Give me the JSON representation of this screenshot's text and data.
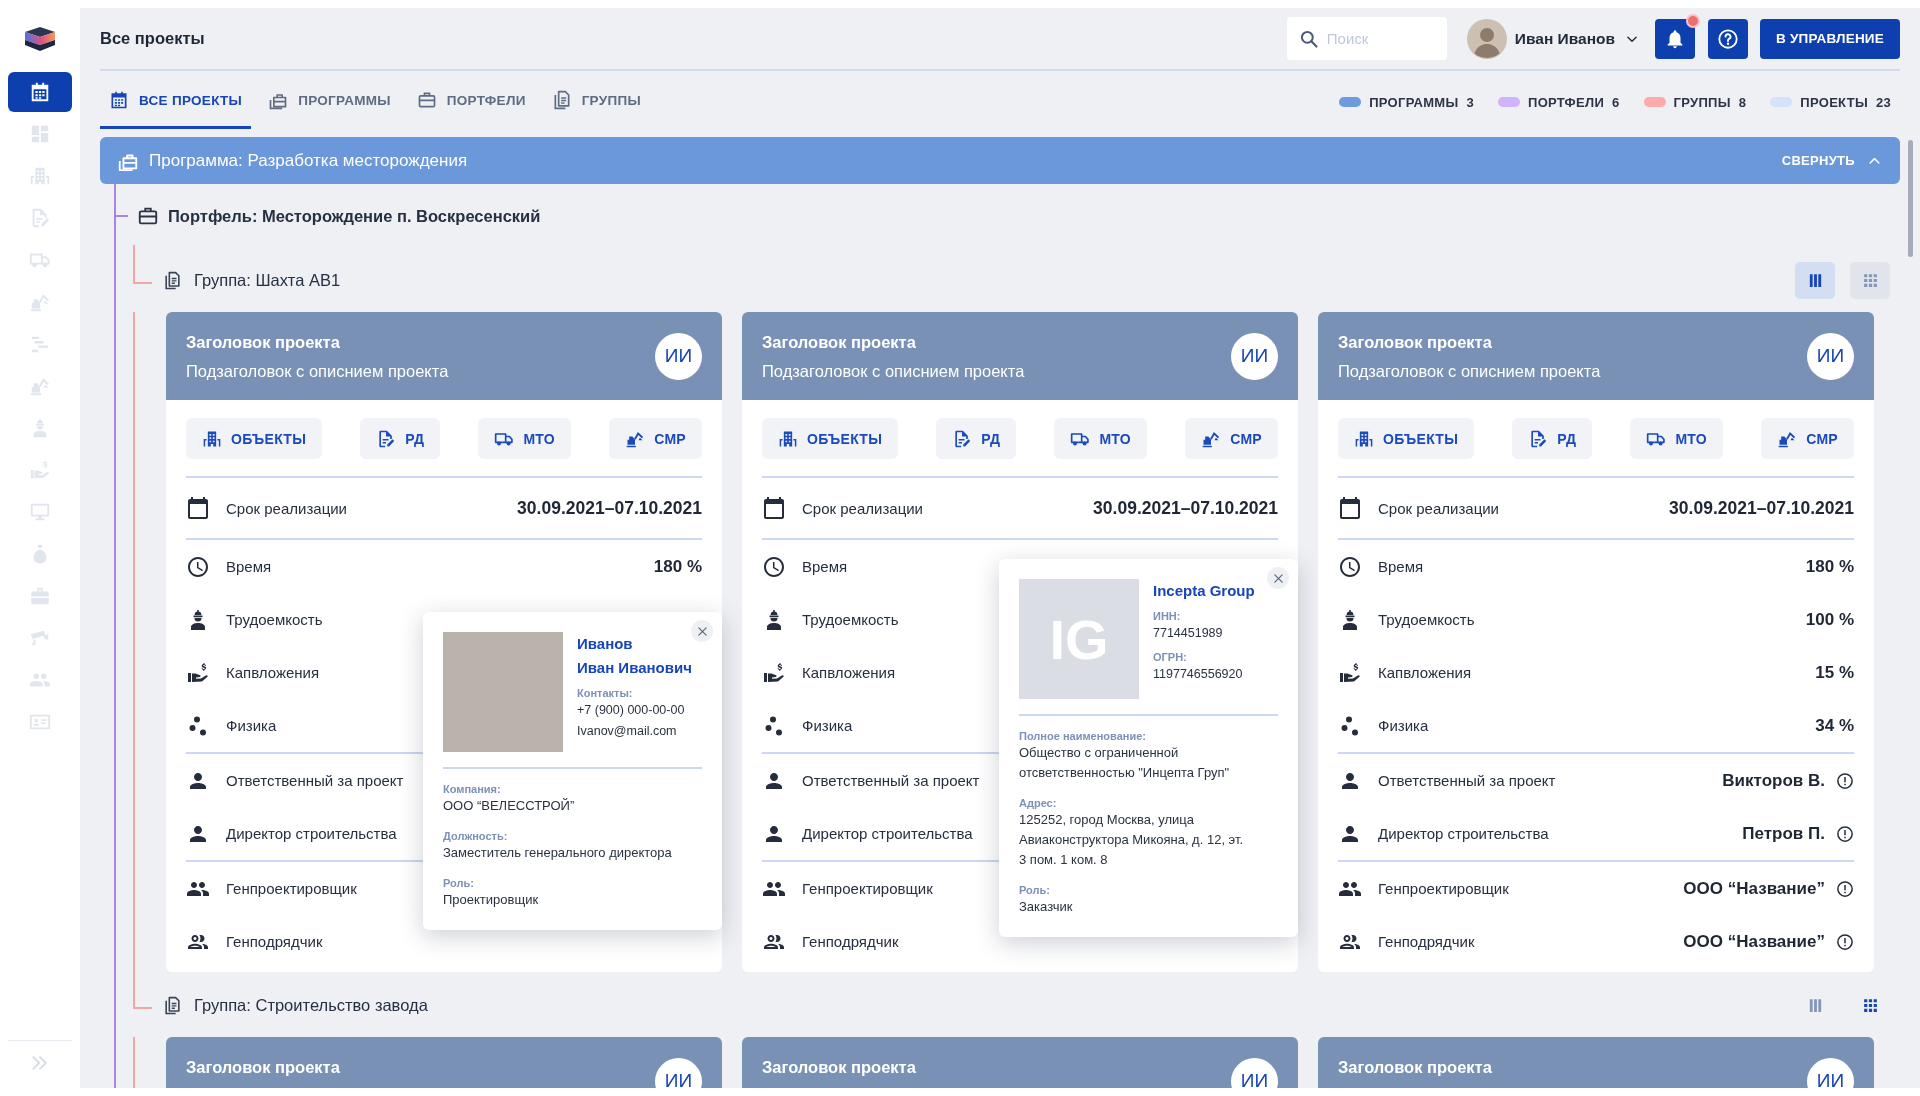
{
  "sidebar": {
    "items": [
      {
        "selected": true
      },
      {
        "selected": false
      },
      {
        "selected": false
      },
      {
        "selected": false
      },
      {
        "selected": false
      },
      {
        "selected": false
      },
      {
        "selected": false
      },
      {
        "selected": false
      },
      {
        "selected": false
      },
      {
        "selected": false
      },
      {
        "selected": false
      },
      {
        "selected": false
      },
      {
        "selected": false
      },
      {
        "selected": false
      },
      {
        "selected": false
      },
      {
        "selected": false
      }
    ]
  },
  "header": {
    "title": "Все проекты",
    "search": {
      "placeholder": "Поиск"
    },
    "user": {
      "name": "Иван Иванов"
    },
    "notifications": {
      "unread": true
    },
    "action_button": "В УПРАВЛЕНИЕ"
  },
  "tabs": [
    {
      "label": "ВСЕ ПРОЕКТЫ",
      "selected": true
    },
    {
      "label": "ПРОГРАММЫ",
      "selected": false
    },
    {
      "label": "ПОРТФЕЛИ",
      "selected": false
    },
    {
      "label": "ГРУППЫ",
      "selected": false
    }
  ],
  "legend": [
    {
      "label": "ПРОГРАММЫ",
      "count": "3",
      "color": "#6f9ade"
    },
    {
      "label": "ПОРТФЕЛИ",
      "count": "6",
      "color": "#d1b3fa"
    },
    {
      "label": "ГРУППЫ",
      "count": "8",
      "color": "#fcabab"
    },
    {
      "label": "ПРОЕКТЫ",
      "count": "23",
      "color": "#d6e1fb"
    }
  ],
  "program": {
    "title": "Программа: Разработка месторождения",
    "collapse_label": "СВЕРНУТЬ",
    "expanded": true,
    "portfolios": [
      {
        "title": "Портфель: Месторождение п. Воскресенский",
        "groups": [
          {
            "title": "Группа: Шахта АВ1",
            "hovered": true,
            "views": [
              {
                "selected": true
              },
              {
                "selected": false
              }
            ],
            "cards": [
              {
                "title": "Заголовок проекта",
                "subtitle": "Подзаголовок с описнием проекта",
                "avatar": "ИИ",
                "actions": [
                  "ОБЪЕКТЫ",
                  "РД",
                  "МТО",
                  "СМР"
                ],
                "sections": [
                  {
                    "rows": [
                      {
                        "label": "Срок реализации",
                        "value": "30.09.2021–07.10.2021"
                      }
                    ]
                  },
                  {
                    "rows": [
                      {
                        "label": "Время",
                        "value": "180 %"
                      },
                      {
                        "label": "Трудоемкость"
                      },
                      {
                        "label": "Капвложения"
                      },
                      {
                        "label": "Физика"
                      }
                    ]
                  },
                  {
                    "rows": [
                      {
                        "label": "Ответственный за проект",
                        "info": false
                      },
                      {
                        "label": "Директор строительства",
                        "info": false
                      }
                    ]
                  },
                  {
                    "rows": [
                      {
                        "label": "Генпроектировщик",
                        "info": false
                      },
                      {
                        "label": "Генподрядчик",
                        "info": false
                      }
                    ]
                  }
                ],
                "popup": {
                  "kind": "person",
                  "name_lines": [
                    "Иванов",
                    "Иван Иванович"
                  ],
                  "top_fields": [
                    {
                      "label": "Контакты:",
                      "values": [
                        "+7 (900) 000-00-00",
                        "Ivanov@mail.com"
                      ]
                    }
                  ],
                  "fields": [
                    {
                      "label": "Компания:",
                      "value": "ООО “ВЕЛЕССТРОЙ”"
                    },
                    {
                      "label": "Должность:",
                      "value": "Заместитель генерального директора"
                    },
                    {
                      "label": "Роль:",
                      "value": "Проектировщик"
                    }
                  ]
                }
              },
              {
                "title": "Заголовок проекта",
                "subtitle": "Подзаголовок с описнием проекта",
                "avatar": "ИИ",
                "actions": [
                  "ОБЪЕКТЫ",
                  "РД",
                  "МТО",
                  "СМР"
                ],
                "sections": [
                  {
                    "rows": [
                      {
                        "label": "Срок реализации",
                        "value": "30.09.2021–07.10.2021"
                      }
                    ]
                  },
                  {
                    "rows": [
                      {
                        "label": "Время"
                      },
                      {
                        "label": "Трудоемкость"
                      },
                      {
                        "label": "Капвложения"
                      },
                      {
                        "label": "Физика"
                      }
                    ]
                  },
                  {
                    "rows": [
                      {
                        "label": "Ответственный за проект",
                        "info": false
                      },
                      {
                        "label": "Директор строительства",
                        "info": false
                      }
                    ]
                  },
                  {
                    "rows": [
                      {
                        "label": "Генпроектировщик",
                        "info": false
                      },
                      {
                        "label": "Генподрядчик",
                        "info": false
                      }
                    ]
                  }
                ],
                "popup": {
                  "kind": "company",
                  "logo_text": "IG",
                  "name_lines": [
                    "Incepta Group"
                  ],
                  "top_fields": [
                    {
                      "label": "ИНН:",
                      "values": [
                        "7714451989"
                      ]
                    },
                    {
                      "label": "ОГРН:",
                      "values": [
                        "1197746556920"
                      ]
                    }
                  ],
                  "fields": [
                    {
                      "label": "Полное наименование:",
                      "value": "Общество с ограниченной отсветственностью \"Инцепта Груп\""
                    },
                    {
                      "label": "Адрес:",
                      "value": "125252, город Москва, улица Авиаконструктора Микояна, д. 12, эт. 3 пом. 1 ком. 8"
                    },
                    {
                      "label": "Роль:",
                      "value": "Заказчик"
                    }
                  ]
                }
              },
              {
                "title": "Заголовок проекта",
                "subtitle": "Подзаголовок с описнием проекта",
                "avatar": "ИИ",
                "actions": [
                  "ОБЪЕКТЫ",
                  "РД",
                  "МТО",
                  "СМР"
                ],
                "sections": [
                  {
                    "rows": [
                      {
                        "label": "Срок реализации",
                        "value": "30.09.2021–07.10.2021"
                      }
                    ]
                  },
                  {
                    "rows": [
                      {
                        "label": "Время",
                        "value": "180 %"
                      },
                      {
                        "label": "Трудоемкость",
                        "value": "100 %"
                      },
                      {
                        "label": "Капвложения",
                        "value": "15 %"
                      },
                      {
                        "label": "Физика",
                        "value": "34 %"
                      }
                    ]
                  },
                  {
                    "rows": [
                      {
                        "label": "Ответственный за проект",
                        "value": "Викторов В.",
                        "info": true
                      },
                      {
                        "label": "Директор строительства",
                        "value": "Петров П.",
                        "info": true
                      }
                    ]
                  },
                  {
                    "rows": [
                      {
                        "label": "Генпроектировщик",
                        "value": "ООО “Название”",
                        "info": true
                      },
                      {
                        "label": "Генподрядчик",
                        "value": "ООО “Название”",
                        "info": true
                      }
                    ]
                  }
                ]
              }
            ]
          },
          {
            "title": "Группа: Строительство завода",
            "hovered": false,
            "views": [
              {
                "selected": false
              },
              {
                "selected": true
              }
            ],
            "cards": [
              {
                "title": "Заголовок проекта",
                "avatar": "ИИ"
              },
              {
                "title": "Заголовок проекта",
                "avatar": "ИИ"
              },
              {
                "title": "Заголовок проекта",
                "avatar": "ИИ"
              }
            ]
          }
        ]
      }
    ]
  }
}
